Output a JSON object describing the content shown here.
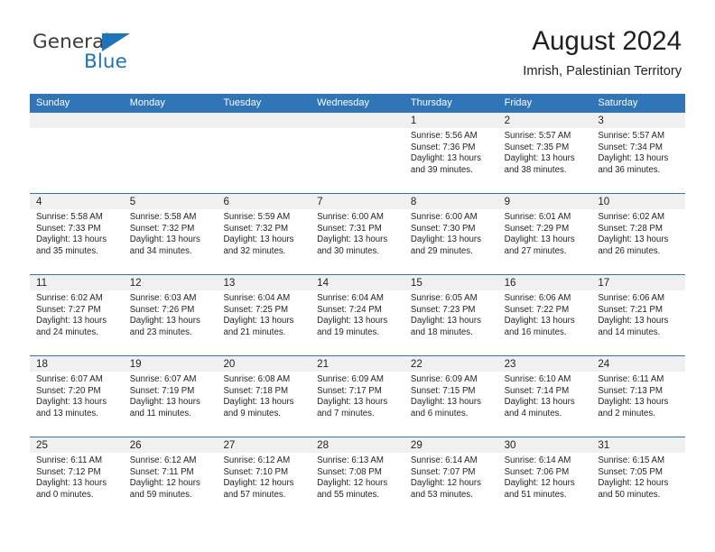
{
  "brand": {
    "name_top": "General",
    "name_bottom": "Blue",
    "triangle_color": "#1b75bb",
    "text_color": "#3c3c3b"
  },
  "header": {
    "title": "August 2024",
    "subtitle": "Imrish, Palestinian Territory"
  },
  "theme": {
    "header_blue": "#3075b8",
    "day_strip_gray": "#f0f0f0",
    "text": "#231f20"
  },
  "weekdays": [
    "Sunday",
    "Monday",
    "Tuesday",
    "Wednesday",
    "Thursday",
    "Friday",
    "Saturday"
  ],
  "labels": {
    "sunrise_prefix": "Sunrise:",
    "sunset_prefix": "Sunset:",
    "daylight_prefix": "Daylight:"
  },
  "weeks": [
    [
      {
        "day": "",
        "line1": "",
        "line2": "",
        "line3": "",
        "line4": ""
      },
      {
        "day": "",
        "line1": "",
        "line2": "",
        "line3": "",
        "line4": ""
      },
      {
        "day": "",
        "line1": "",
        "line2": "",
        "line3": "",
        "line4": ""
      },
      {
        "day": "",
        "line1": "",
        "line2": "",
        "line3": "",
        "line4": ""
      },
      {
        "day": "1",
        "line1": "Sunrise: 5:56 AM",
        "line2": "Sunset: 7:36 PM",
        "line3": "Daylight: 13 hours",
        "line4": "and 39 minutes."
      },
      {
        "day": "2",
        "line1": "Sunrise: 5:57 AM",
        "line2": "Sunset: 7:35 PM",
        "line3": "Daylight: 13 hours",
        "line4": "and 38 minutes."
      },
      {
        "day": "3",
        "line1": "Sunrise: 5:57 AM",
        "line2": "Sunset: 7:34 PM",
        "line3": "Daylight: 13 hours",
        "line4": "and 36 minutes."
      }
    ],
    [
      {
        "day": "4",
        "line1": "Sunrise: 5:58 AM",
        "line2": "Sunset: 7:33 PM",
        "line3": "Daylight: 13 hours",
        "line4": "and 35 minutes."
      },
      {
        "day": "5",
        "line1": "Sunrise: 5:58 AM",
        "line2": "Sunset: 7:32 PM",
        "line3": "Daylight: 13 hours",
        "line4": "and 34 minutes."
      },
      {
        "day": "6",
        "line1": "Sunrise: 5:59 AM",
        "line2": "Sunset: 7:32 PM",
        "line3": "Daylight: 13 hours",
        "line4": "and 32 minutes."
      },
      {
        "day": "7",
        "line1": "Sunrise: 6:00 AM",
        "line2": "Sunset: 7:31 PM",
        "line3": "Daylight: 13 hours",
        "line4": "and 30 minutes."
      },
      {
        "day": "8",
        "line1": "Sunrise: 6:00 AM",
        "line2": "Sunset: 7:30 PM",
        "line3": "Daylight: 13 hours",
        "line4": "and 29 minutes."
      },
      {
        "day": "9",
        "line1": "Sunrise: 6:01 AM",
        "line2": "Sunset: 7:29 PM",
        "line3": "Daylight: 13 hours",
        "line4": "and 27 minutes."
      },
      {
        "day": "10",
        "line1": "Sunrise: 6:02 AM",
        "line2": "Sunset: 7:28 PM",
        "line3": "Daylight: 13 hours",
        "line4": "and 26 minutes."
      }
    ],
    [
      {
        "day": "11",
        "line1": "Sunrise: 6:02 AM",
        "line2": "Sunset: 7:27 PM",
        "line3": "Daylight: 13 hours",
        "line4": "and 24 minutes."
      },
      {
        "day": "12",
        "line1": "Sunrise: 6:03 AM",
        "line2": "Sunset: 7:26 PM",
        "line3": "Daylight: 13 hours",
        "line4": "and 23 minutes."
      },
      {
        "day": "13",
        "line1": "Sunrise: 6:04 AM",
        "line2": "Sunset: 7:25 PM",
        "line3": "Daylight: 13 hours",
        "line4": "and 21 minutes."
      },
      {
        "day": "14",
        "line1": "Sunrise: 6:04 AM",
        "line2": "Sunset: 7:24 PM",
        "line3": "Daylight: 13 hours",
        "line4": "and 19 minutes."
      },
      {
        "day": "15",
        "line1": "Sunrise: 6:05 AM",
        "line2": "Sunset: 7:23 PM",
        "line3": "Daylight: 13 hours",
        "line4": "and 18 minutes."
      },
      {
        "day": "16",
        "line1": "Sunrise: 6:06 AM",
        "line2": "Sunset: 7:22 PM",
        "line3": "Daylight: 13 hours",
        "line4": "and 16 minutes."
      },
      {
        "day": "17",
        "line1": "Sunrise: 6:06 AM",
        "line2": "Sunset: 7:21 PM",
        "line3": "Daylight: 13 hours",
        "line4": "and 14 minutes."
      }
    ],
    [
      {
        "day": "18",
        "line1": "Sunrise: 6:07 AM",
        "line2": "Sunset: 7:20 PM",
        "line3": "Daylight: 13 hours",
        "line4": "and 13 minutes."
      },
      {
        "day": "19",
        "line1": "Sunrise: 6:07 AM",
        "line2": "Sunset: 7:19 PM",
        "line3": "Daylight: 13 hours",
        "line4": "and 11 minutes."
      },
      {
        "day": "20",
        "line1": "Sunrise: 6:08 AM",
        "line2": "Sunset: 7:18 PM",
        "line3": "Daylight: 13 hours",
        "line4": "and 9 minutes."
      },
      {
        "day": "21",
        "line1": "Sunrise: 6:09 AM",
        "line2": "Sunset: 7:17 PM",
        "line3": "Daylight: 13 hours",
        "line4": "and 7 minutes."
      },
      {
        "day": "22",
        "line1": "Sunrise: 6:09 AM",
        "line2": "Sunset: 7:15 PM",
        "line3": "Daylight: 13 hours",
        "line4": "and 6 minutes."
      },
      {
        "day": "23",
        "line1": "Sunrise: 6:10 AM",
        "line2": "Sunset: 7:14 PM",
        "line3": "Daylight: 13 hours",
        "line4": "and 4 minutes."
      },
      {
        "day": "24",
        "line1": "Sunrise: 6:11 AM",
        "line2": "Sunset: 7:13 PM",
        "line3": "Daylight: 13 hours",
        "line4": "and 2 minutes."
      }
    ],
    [
      {
        "day": "25",
        "line1": "Sunrise: 6:11 AM",
        "line2": "Sunset: 7:12 PM",
        "line3": "Daylight: 13 hours",
        "line4": "and 0 minutes."
      },
      {
        "day": "26",
        "line1": "Sunrise: 6:12 AM",
        "line2": "Sunset: 7:11 PM",
        "line3": "Daylight: 12 hours",
        "line4": "and 59 minutes."
      },
      {
        "day": "27",
        "line1": "Sunrise: 6:12 AM",
        "line2": "Sunset: 7:10 PM",
        "line3": "Daylight: 12 hours",
        "line4": "and 57 minutes."
      },
      {
        "day": "28",
        "line1": "Sunrise: 6:13 AM",
        "line2": "Sunset: 7:08 PM",
        "line3": "Daylight: 12 hours",
        "line4": "and 55 minutes."
      },
      {
        "day": "29",
        "line1": "Sunrise: 6:14 AM",
        "line2": "Sunset: 7:07 PM",
        "line3": "Daylight: 12 hours",
        "line4": "and 53 minutes."
      },
      {
        "day": "30",
        "line1": "Sunrise: 6:14 AM",
        "line2": "Sunset: 7:06 PM",
        "line3": "Daylight: 12 hours",
        "line4": "and 51 minutes."
      },
      {
        "day": "31",
        "line1": "Sunrise: 6:15 AM",
        "line2": "Sunset: 7:05 PM",
        "line3": "Daylight: 12 hours",
        "line4": "and 50 minutes."
      }
    ]
  ]
}
